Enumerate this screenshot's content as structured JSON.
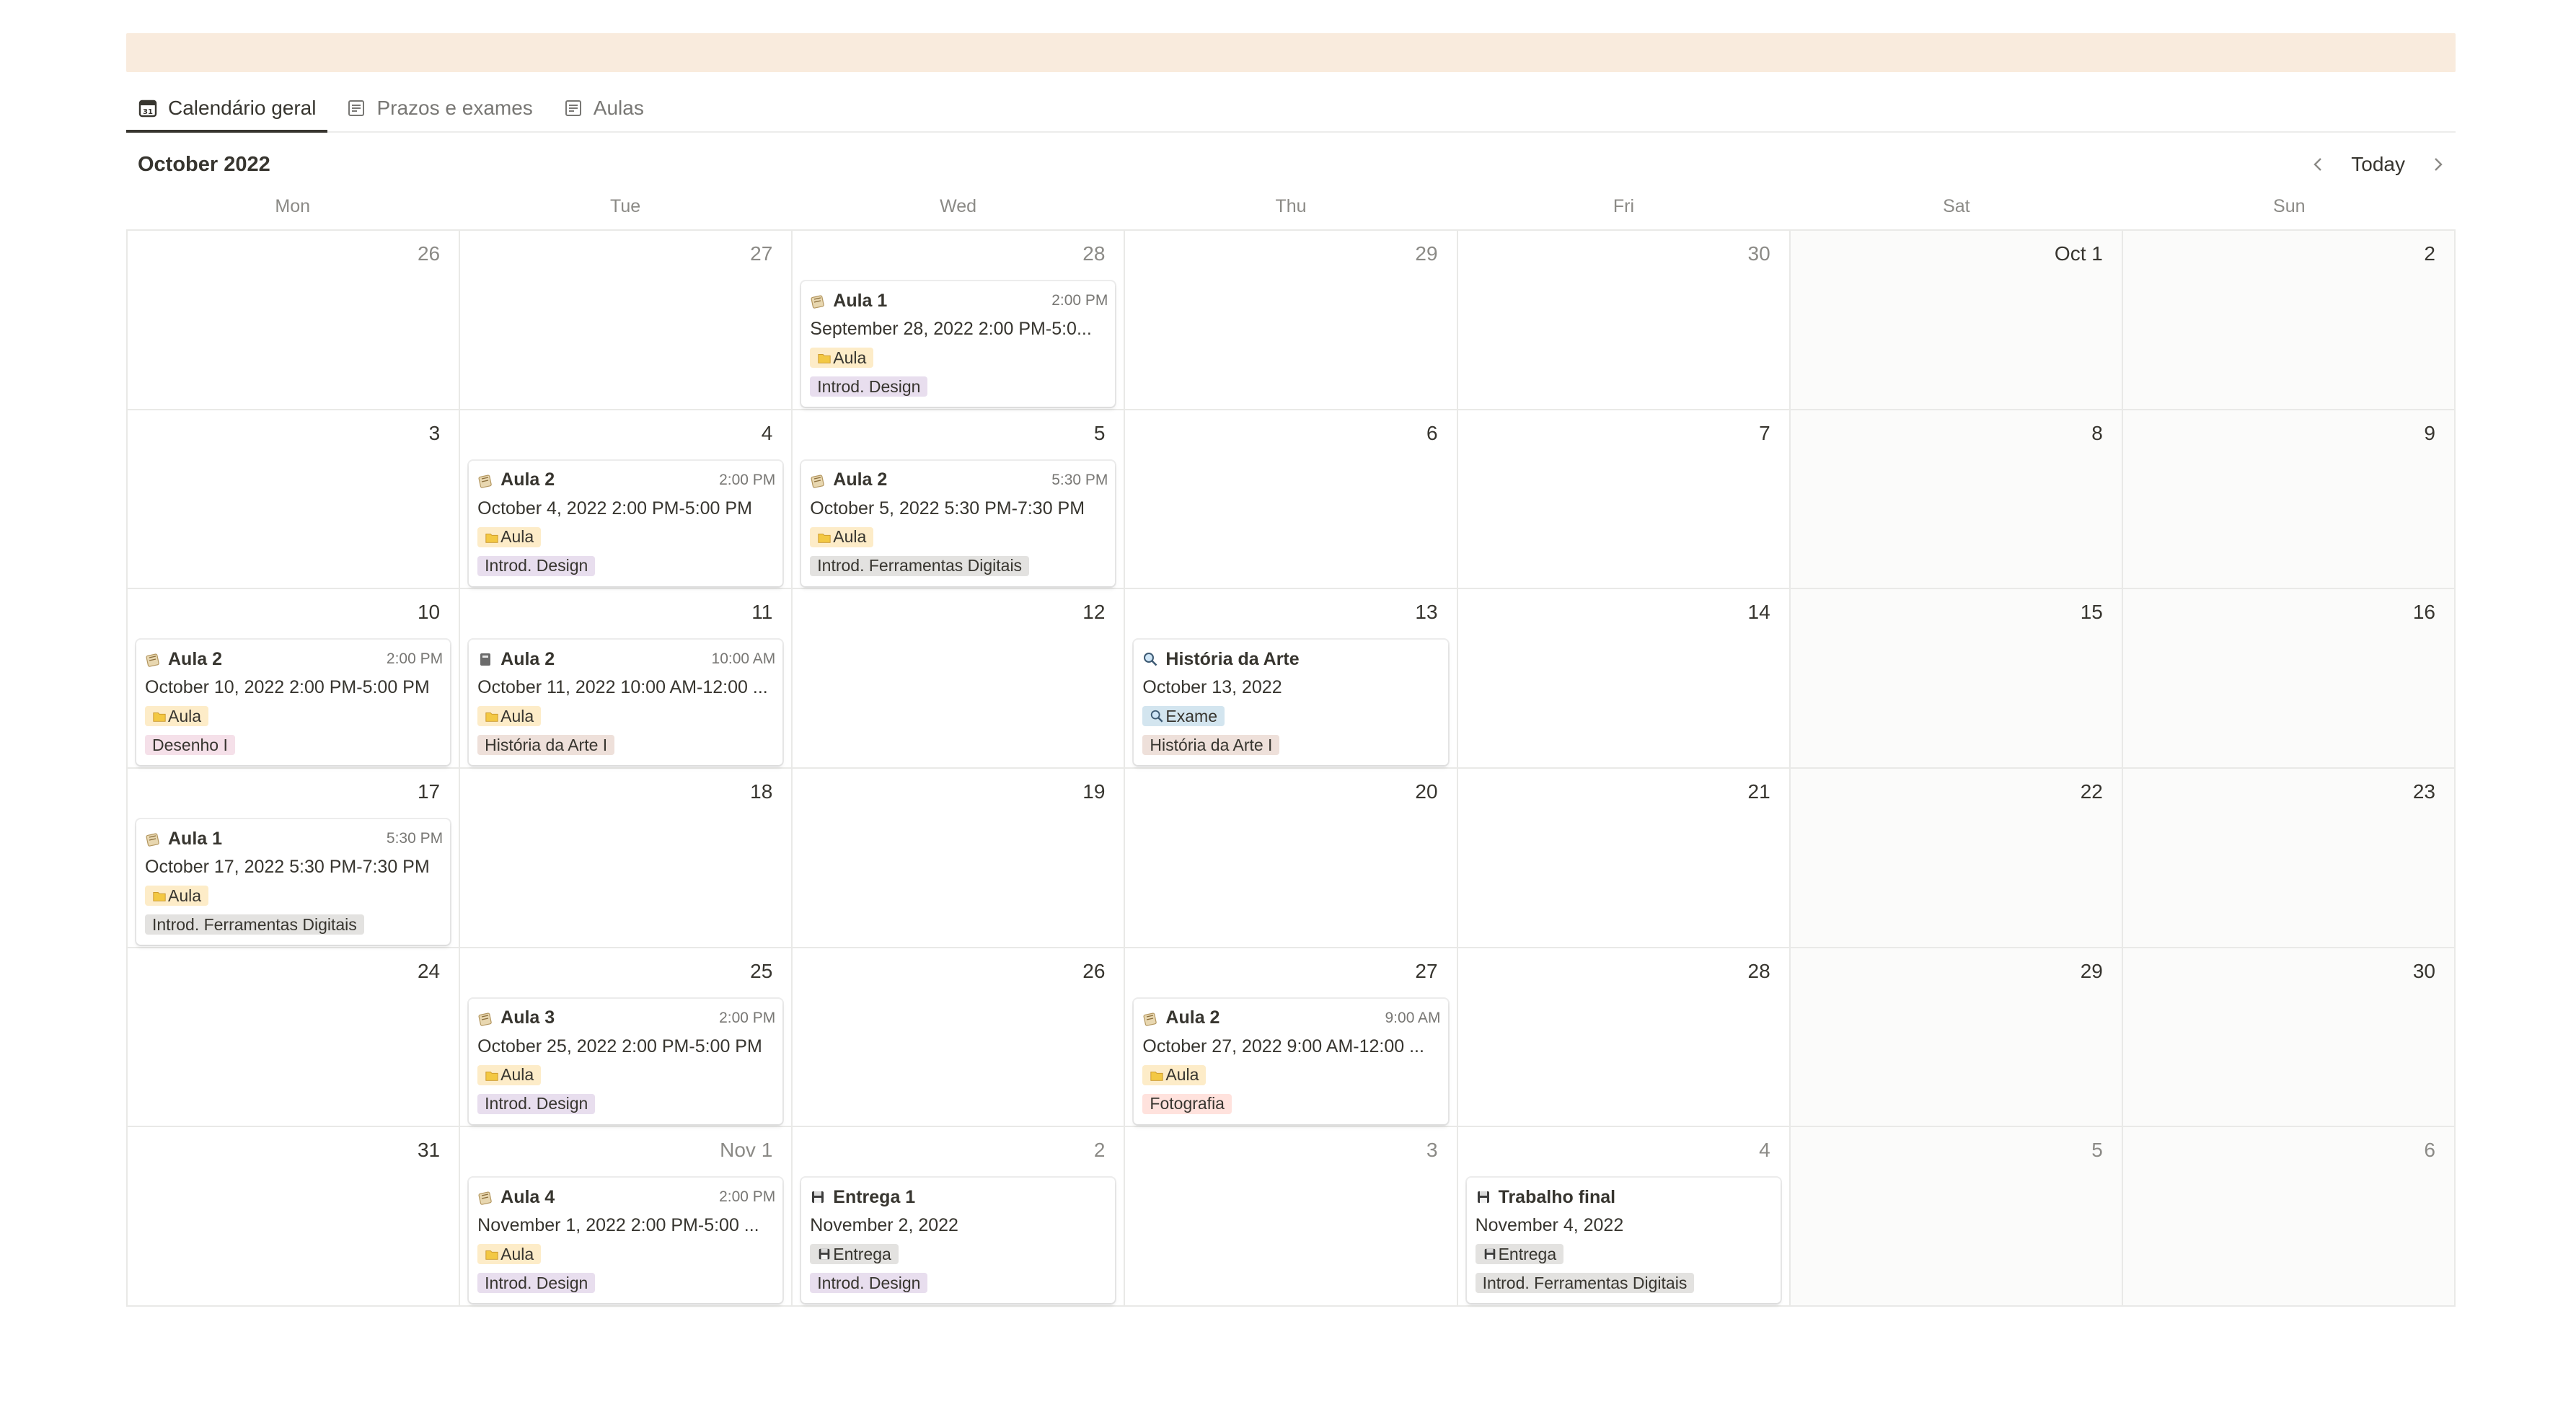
{
  "tabs": [
    {
      "label": "Calendário geral",
      "icon": "calendar-icon",
      "active": true
    },
    {
      "label": "Prazos e exames",
      "icon": "page-icon",
      "active": false
    },
    {
      "label": "Aulas",
      "icon": "page-icon",
      "active": false
    }
  ],
  "calendar": {
    "month_title": "October 2022",
    "today_label": "Today",
    "weekdays": [
      "Mon",
      "Tue",
      "Wed",
      "Thu",
      "Fri",
      "Sat",
      "Sun"
    ]
  },
  "weeks": [
    [
      {
        "day": "26",
        "muted": true
      },
      {
        "day": "27",
        "muted": true
      },
      {
        "day": "28",
        "muted": true,
        "events": [
          {
            "icon": "notebook-icon",
            "title": "Aula 1",
            "time": "2:00 PM",
            "date": "September 28, 2022 2:00 PM-5:0...",
            "type": "Aula",
            "type_icon": "folder-icon",
            "type_color": "#fdecc8",
            "course": "Introd. Design",
            "course_color": "#e8deee"
          }
        ]
      },
      {
        "day": "29",
        "muted": true
      },
      {
        "day": "30",
        "muted": true
      },
      {
        "day": "Oct 1",
        "muted": false
      },
      {
        "day": "2",
        "muted": false
      }
    ],
    [
      {
        "day": "3",
        "muted": false
      },
      {
        "day": "4",
        "muted": false,
        "events": [
          {
            "icon": "notebook-icon",
            "title": "Aula 2",
            "time": "2:00 PM",
            "date": "October 4, 2022 2:00 PM-5:00 PM",
            "type": "Aula",
            "type_icon": "folder-icon",
            "type_color": "#fdecc8",
            "course": "Introd. Design",
            "course_color": "#e8deee"
          }
        ]
      },
      {
        "day": "5",
        "muted": false,
        "events": [
          {
            "icon": "notebook-icon",
            "title": "Aula 2",
            "time": "5:30 PM",
            "date": "October 5, 2022 5:30 PM-7:30 PM",
            "type": "Aula",
            "type_icon": "folder-icon",
            "type_color": "#fdecc8",
            "course": "Introd. Ferramentas Digitais",
            "course_color": "#e3e2e0"
          }
        ]
      },
      {
        "day": "6",
        "muted": false
      },
      {
        "day": "7",
        "muted": false
      },
      {
        "day": "8",
        "muted": false
      },
      {
        "day": "9",
        "muted": false
      }
    ],
    [
      {
        "day": "10",
        "muted": false,
        "events": [
          {
            "icon": "notebook-icon",
            "title": "Aula 2",
            "time": "2:00 PM",
            "date": "October 10, 2022 2:00 PM-5:00 PM",
            "type": "Aula",
            "type_icon": "folder-icon",
            "type_color": "#fdecc8",
            "course": "Desenho I",
            "course_color": "#f5e0e9"
          }
        ]
      },
      {
        "day": "11",
        "muted": false,
        "events": [
          {
            "icon": "book-icon",
            "title": "Aula 2",
            "time": "10:00 AM",
            "date": "October 11, 2022 10:00 AM-12:00 ...",
            "type": "Aula",
            "type_icon": "folder-icon",
            "type_color": "#fdecc8",
            "course": "História da Arte I",
            "course_color": "#eee0da"
          }
        ]
      },
      {
        "day": "12",
        "muted": false
      },
      {
        "day": "13",
        "muted": false,
        "events": [
          {
            "icon": "magnifier-icon",
            "title": "História da Arte",
            "time": "",
            "date": "October 13, 2022",
            "type": "Exame",
            "type_icon": "magnifier-icon",
            "type_color": "#d3e5ef",
            "course": "História da Arte I",
            "course_color": "#eee0da"
          }
        ]
      },
      {
        "day": "14",
        "muted": false
      },
      {
        "day": "15",
        "muted": false
      },
      {
        "day": "16",
        "muted": false
      }
    ],
    [
      {
        "day": "17",
        "muted": false,
        "events": [
          {
            "icon": "notebook-icon",
            "title": "Aula 1",
            "time": "5:30 PM",
            "date": "October 17, 2022 5:30 PM-7:30 PM",
            "type": "Aula",
            "type_icon": "folder-icon",
            "type_color": "#fdecc8",
            "course": "Introd. Ferramentas Digitais",
            "course_color": "#e3e2e0"
          }
        ]
      },
      {
        "day": "18",
        "muted": false
      },
      {
        "day": "19",
        "muted": false
      },
      {
        "day": "20",
        "muted": false
      },
      {
        "day": "21",
        "muted": false
      },
      {
        "day": "22",
        "muted": false
      },
      {
        "day": "23",
        "muted": false
      }
    ],
    [
      {
        "day": "24",
        "muted": false
      },
      {
        "day": "25",
        "muted": false,
        "events": [
          {
            "icon": "notebook-icon",
            "title": "Aula 3",
            "time": "2:00 PM",
            "date": "October 25, 2022 2:00 PM-5:00 PM",
            "type": "Aula",
            "type_icon": "folder-icon",
            "type_color": "#fdecc8",
            "course": "Introd. Design",
            "course_color": "#e8deee"
          }
        ]
      },
      {
        "day": "26",
        "muted": false
      },
      {
        "day": "27",
        "muted": false,
        "events": [
          {
            "icon": "notebook-icon",
            "title": "Aula 2",
            "time": "9:00 AM",
            "date": "October 27, 2022 9:00 AM-12:00 ...",
            "type": "Aula",
            "type_icon": "folder-icon",
            "type_color": "#fdecc8",
            "course": "Fotografia",
            "course_color": "#ffe2dd"
          }
        ]
      },
      {
        "day": "28",
        "muted": false
      },
      {
        "day": "29",
        "muted": false
      },
      {
        "day": "30",
        "muted": false
      }
    ],
    [
      {
        "day": "31",
        "muted": false
      },
      {
        "day": "Nov 1",
        "muted": true,
        "events": [
          {
            "icon": "notebook-icon",
            "title": "Aula 4",
            "time": "2:00 PM",
            "date": "November 1, 2022 2:00 PM-5:00 ...",
            "type": "Aula",
            "type_icon": "folder-icon",
            "type_color": "#fdecc8",
            "course": "Introd. Design",
            "course_color": "#e8deee"
          }
        ]
      },
      {
        "day": "2",
        "muted": true,
        "events": [
          {
            "icon": "floppy-icon",
            "title": "Entrega 1",
            "time": "",
            "date": "November 2, 2022",
            "type": "Entrega",
            "type_icon": "floppy-icon",
            "type_color": "#e3e2e0",
            "course": "Introd. Design",
            "course_color": "#e8deee"
          }
        ]
      },
      {
        "day": "3",
        "muted": true
      },
      {
        "day": "4",
        "muted": true,
        "events": [
          {
            "icon": "floppy-icon",
            "title": "Trabalho final",
            "time": "",
            "date": "November 4, 2022",
            "type": "Entrega",
            "type_icon": "floppy-icon",
            "type_color": "#e3e2e0",
            "course": "Introd. Ferramentas Digitais",
            "course_color": "#e3e2e0"
          }
        ]
      },
      {
        "day": "5",
        "muted": true
      },
      {
        "day": "6",
        "muted": true
      }
    ]
  ]
}
